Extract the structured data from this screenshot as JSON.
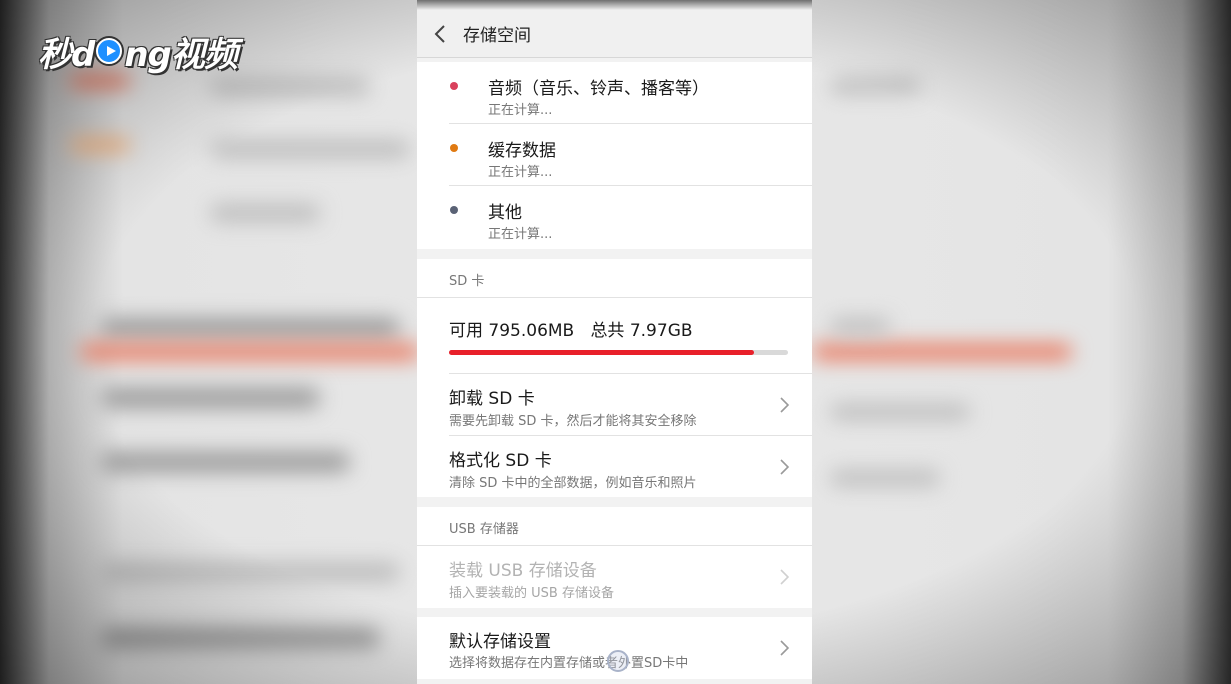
{
  "watermark": {
    "text_left": "秒d",
    "text_right": "ng视频"
  },
  "header": {
    "title": "存储空间"
  },
  "categories": [
    {
      "label": "音频（音乐、铃声、播客等）",
      "status": "正在计算...",
      "color": "#d9415c"
    },
    {
      "label": "缓存数据",
      "status": "正在计算...",
      "color": "#e07a12"
    },
    {
      "label": "其他",
      "status": "正在计算...",
      "color": "#5a6275"
    }
  ],
  "sd_card": {
    "section_title": "SD 卡",
    "available": "可用 795.06MB",
    "total": "总共 7.97GB",
    "used_fraction": 0.9,
    "bar_color": "#e8202a",
    "unmount": {
      "title": "卸载 SD 卡",
      "subtitle": "需要先卸载 SD 卡，然后才能将其安全移除"
    },
    "format": {
      "title": "格式化 SD 卡",
      "subtitle": "清除 SD 卡中的全部数据，例如音乐和照片"
    }
  },
  "usb": {
    "section_title": "USB 存储器",
    "mount": {
      "title": "装载 USB 存储设备",
      "subtitle": "插入要装载的 USB 存储设备"
    }
  },
  "default_storage": {
    "title": "默认存储设置",
    "subtitle": "选择将数据存在内置存储或者外置SD卡中"
  }
}
